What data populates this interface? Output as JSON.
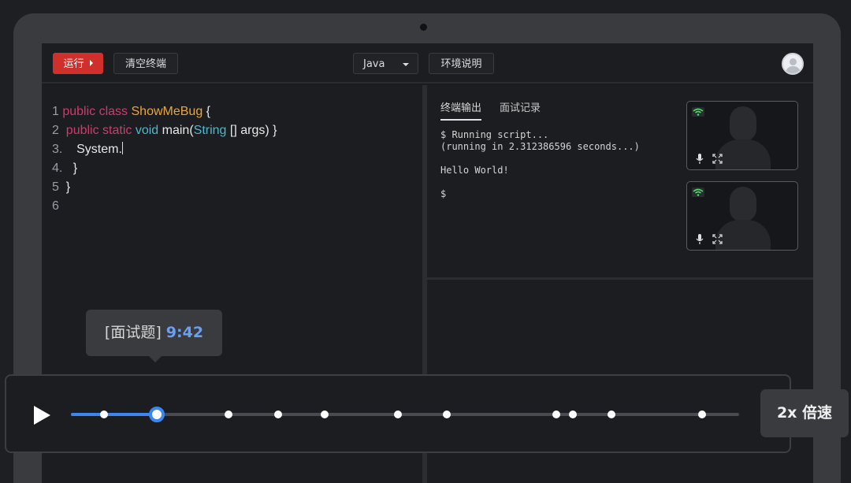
{
  "toolbar": {
    "run_label": "运行",
    "clear_label": "清空终端",
    "language": "Java",
    "env_label": "环境说明"
  },
  "editor": {
    "lines": [
      {
        "num": "1",
        "tokens": [
          {
            "t": "public class ",
            "c": "kw"
          },
          {
            "t": "ShowMeBug",
            "c": "cls"
          },
          {
            "t": " {",
            "c": "pl"
          }
        ]
      },
      {
        "num": "2",
        "tokens": [
          {
            "t": " public static ",
            "c": "kw"
          },
          {
            "t": "void",
            "c": "ty"
          },
          {
            "t": " main(",
            "c": "pl"
          },
          {
            "t": "String",
            "c": "ty"
          },
          {
            "t": " [] args) }",
            "c": "pl"
          }
        ]
      },
      {
        "num": "3.",
        "tokens": [
          {
            "t": "   System.",
            "c": "pl"
          }
        ]
      },
      {
        "num": "4.",
        "tokens": [
          {
            "t": "  }",
            "c": "pl"
          }
        ]
      },
      {
        "num": "5",
        "tokens": [
          {
            "t": " }",
            "c": "pl"
          }
        ]
      },
      {
        "num": "6",
        "tokens": []
      }
    ]
  },
  "terminal": {
    "tab_output": "终端输出",
    "tab_log": "面试记录",
    "output": "$ Running script...\n(running in 2.312386596 seconds...)\n\nHello World!\n\n$"
  },
  "tooltip": {
    "label": "[面试题]",
    "time": "9:42"
  },
  "player": {
    "progress": 0.129,
    "markers": [
      0.049,
      0.129,
      0.236,
      0.31,
      0.38,
      0.489,
      0.562,
      0.727,
      0.751,
      0.809,
      0.945
    ],
    "speed_label": "2x 倍速"
  },
  "colors": {
    "keyword": "#d13a6a",
    "class": "#e9a53a",
    "type": "#4fb7cc",
    "accent": "#3b86f1",
    "run": "#d0302b",
    "signal": "#4cd964"
  },
  "icons": [
    "play-icon",
    "wifi-icon",
    "mic-icon",
    "expand-icon",
    "avatar-icon",
    "chevron-down-icon"
  ]
}
